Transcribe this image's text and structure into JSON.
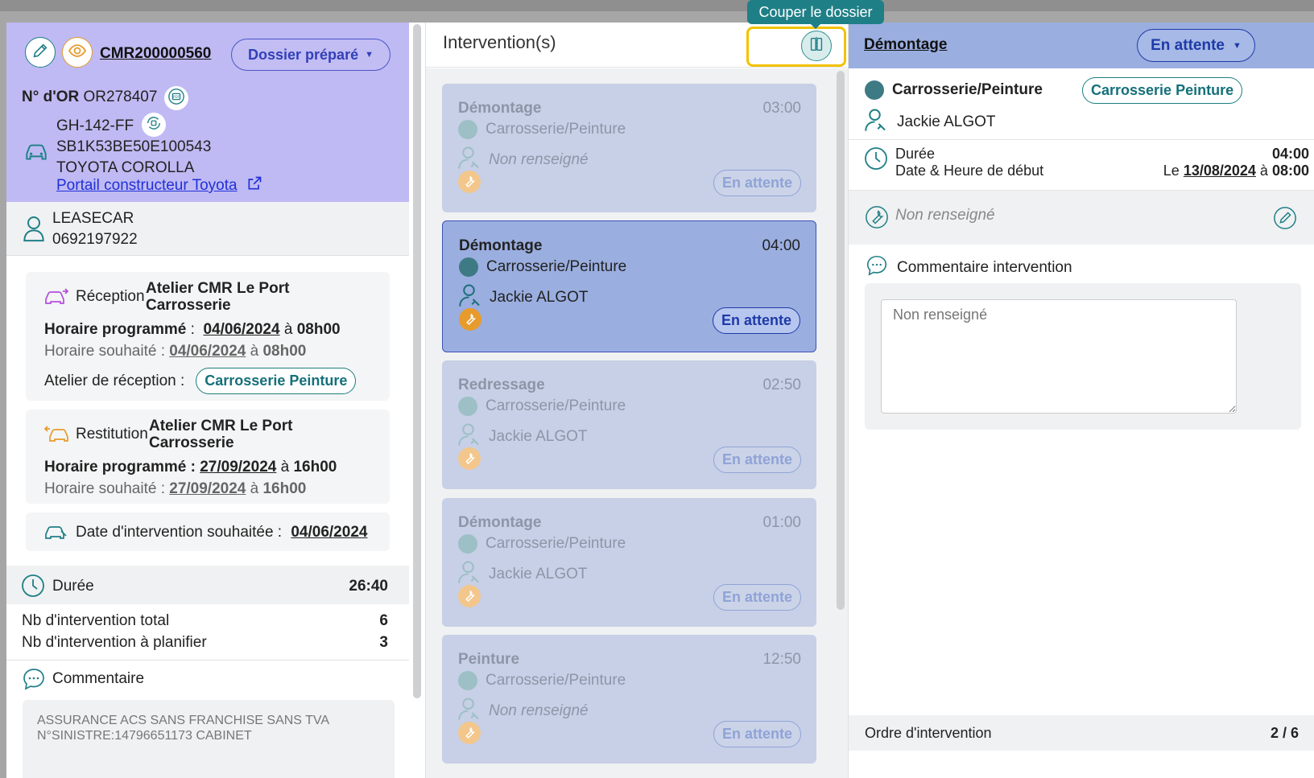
{
  "tooltip": "Couper le dossier",
  "dossier": {
    "id": "CMR200000560",
    "status": "Dossier préparé",
    "or_label": "N° d'OR",
    "or_number": "OR278407",
    "plate": "GH-142-FF",
    "vin": "SB1K53BE50E100543",
    "model": "TOYOTA COROLLA",
    "portal_link": "Portail constructeur Toyota"
  },
  "client": {
    "name": "LEASECAR",
    "phone": "0692197922"
  },
  "reception": {
    "label": "Réception",
    "atelier_line1": "Atelier CMR Le Port",
    "atelier_line2": "Carrosserie",
    "prog_label": "Horaire programmé",
    "prog_sep": " : ",
    "prog_date": "04/06/2024",
    "prog_a": "à",
    "prog_time": "08h00",
    "wish_label": "Horaire souhaité :",
    "wish_date": "04/06/2024",
    "wish_a": "à",
    "wish_time": "08h00",
    "atelier_label": "Atelier de réception :",
    "atelier_pill": "Carrosserie Peinture"
  },
  "restitution": {
    "label": "Restitution",
    "atelier_line1": "Atelier CMR Le Port",
    "atelier_line2": "Carrosserie",
    "prog_label": "Horaire programmé :",
    "prog_date": "27/09/2024",
    "prog_a": "à",
    "prog_time": "16h00",
    "wish_label": "Horaire souhaité :",
    "wish_date": "27/09/2024",
    "wish_a": "à",
    "wish_time": "16h00"
  },
  "wish_intervention": {
    "label": "Date d'intervention souhaitée :",
    "date": "04/06/2024"
  },
  "summary": {
    "duree_label": "Durée",
    "duree_value": "26:40",
    "total_label": "Nb d'intervention total",
    "total_value": "6",
    "plan_label": "Nb d'intervention à planifier",
    "plan_value": "3",
    "comment_label": "Commentaire",
    "comment_text": "ASSURANCE ACS SANS FRANCHISE SANS TVA N°SINISTRE:14796651173 CABINET"
  },
  "middle": {
    "title": "Intervention(s)",
    "cards": [
      {
        "name": "Démontage",
        "time": "03:00",
        "category": "Carrosserie/Peinture",
        "tech": "Non renseigné",
        "status": "En attente"
      },
      {
        "name": "Démontage",
        "time": "04:00",
        "category": "Carrosserie/Peinture",
        "tech": "Jackie ALGOT",
        "status": "En attente"
      },
      {
        "name": "Redressage",
        "time": "02:50",
        "category": "Carrosserie/Peinture",
        "tech": "Jackie ALGOT",
        "status": "En attente"
      },
      {
        "name": "Démontage",
        "time": "01:00",
        "category": "Carrosserie/Peinture",
        "tech": "Jackie ALGOT",
        "status": "En attente"
      },
      {
        "name": "Peinture",
        "time": "12:50",
        "category": "Carrosserie/Peinture",
        "tech": "Non renseigné",
        "status": "En attente"
      }
    ]
  },
  "detail": {
    "title": "Démontage",
    "status": "En attente",
    "category": "Carrosserie/Peinture",
    "category_pill": "Carrosserie Peinture",
    "tech": "Jackie ALGOT",
    "duree_label": "Durée",
    "duree_value": "04:00",
    "start_label": "Date & Heure de début",
    "start_le": "Le",
    "start_date": "13/08/2024",
    "start_a": "à",
    "start_time": "08:00",
    "tool_text": "Non renseigné",
    "comment_label": "Commentaire intervention",
    "comment_placeholder": "Non renseigné",
    "order_label": "Ordre d'intervention",
    "order_value": "2 / 6"
  },
  "colors": {
    "purple_header": "#bfbaf3",
    "active_card": "#9aaee0",
    "teal": "#1f7f87",
    "highlight": "#f2c200"
  }
}
